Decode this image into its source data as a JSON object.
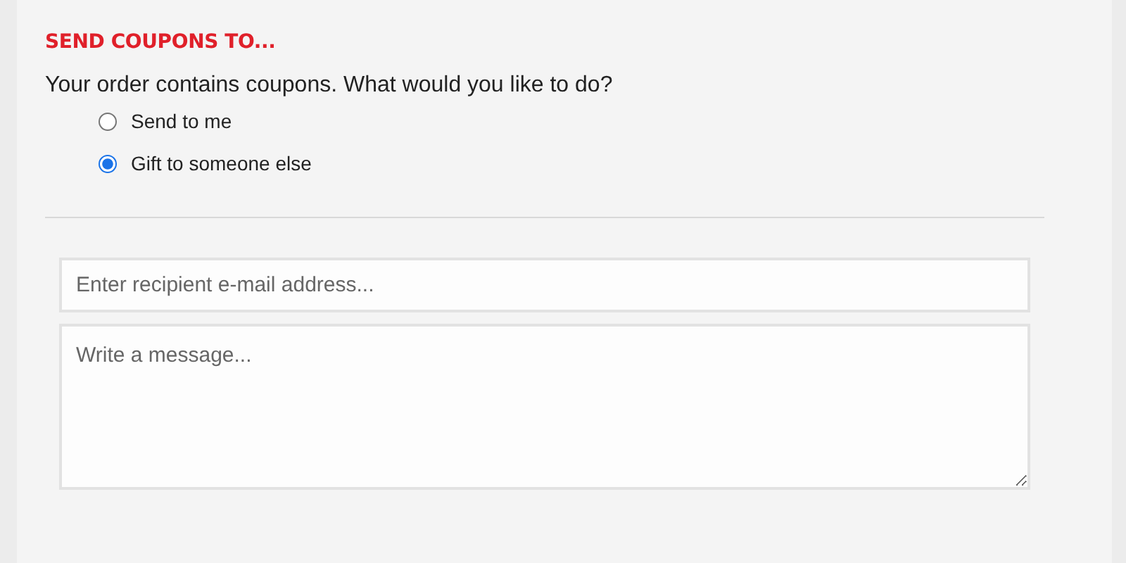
{
  "heading": "SEND COUPONS TO...",
  "question": "Your order contains coupons. What would you like to do?",
  "options": [
    {
      "label": "Send to me",
      "selected": false
    },
    {
      "label": "Gift to someone else",
      "selected": true
    }
  ],
  "email": {
    "placeholder": "Enter recipient e-mail address..."
  },
  "message": {
    "placeholder": "Write a message..."
  }
}
